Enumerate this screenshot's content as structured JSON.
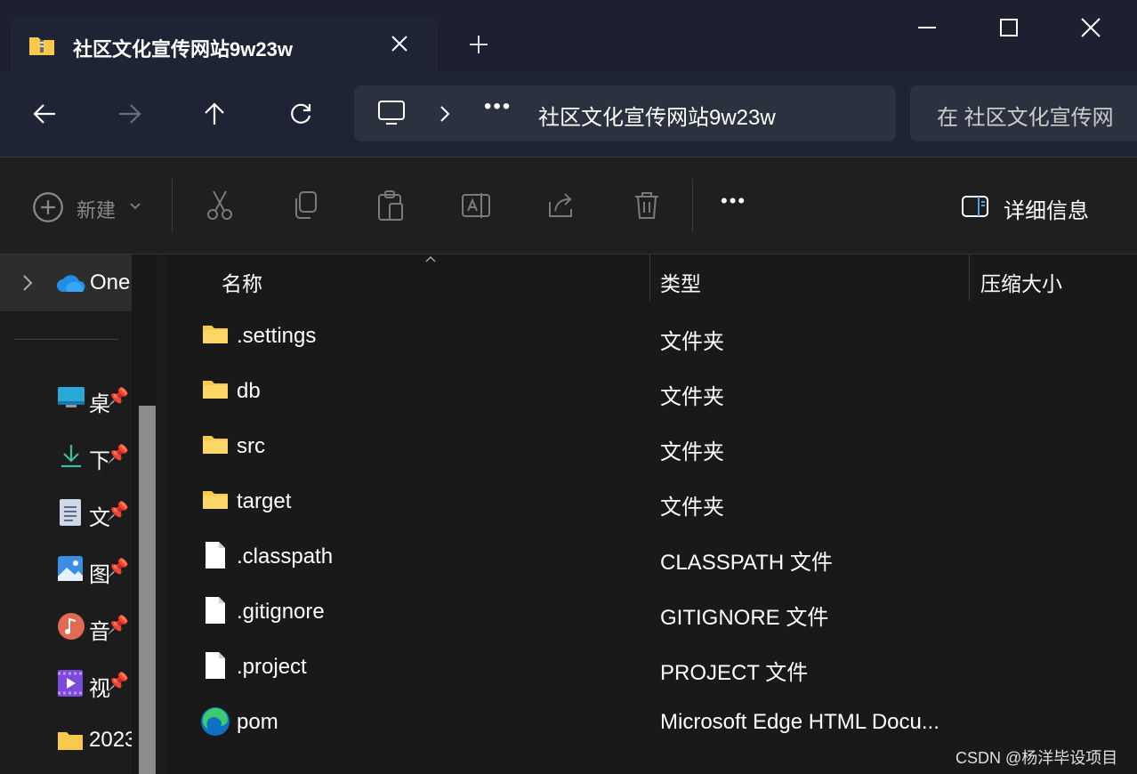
{
  "window": {
    "tab_title": "社区文化宣传网站9w23w",
    "tab_close_icon": "close-icon",
    "new_tab_icon": "plus-icon"
  },
  "nav": {
    "address_path": "社区文化宣传网站9w23w",
    "search_placeholder": "在 社区文化宣传网"
  },
  "command_bar": {
    "new_label": "新建",
    "details_label": "详细信息"
  },
  "sidebar": {
    "onedrive_label": "One",
    "items": [
      {
        "label": "桌",
        "icon": "desktop-icon"
      },
      {
        "label": "下",
        "icon": "download-icon"
      },
      {
        "label": "文",
        "icon": "documents-icon"
      },
      {
        "label": "图",
        "icon": "pictures-icon"
      },
      {
        "label": "音",
        "icon": "music-icon"
      },
      {
        "label": "视",
        "icon": "videos-icon"
      },
      {
        "label": "2023",
        "icon": "folder-icon"
      }
    ]
  },
  "file_list": {
    "columns": [
      "名称",
      "类型",
      "压缩大小"
    ],
    "rows": [
      {
        "name": ".settings",
        "type": "文件夹",
        "icon": "folder-icon"
      },
      {
        "name": "db",
        "type": "文件夹",
        "icon": "folder-icon"
      },
      {
        "name": "src",
        "type": "文件夹",
        "icon": "folder-icon"
      },
      {
        "name": "target",
        "type": "文件夹",
        "icon": "folder-icon"
      },
      {
        "name": ".classpath",
        "type": "CLASSPATH 文件",
        "icon": "file-icon"
      },
      {
        "name": ".gitignore",
        "type": "GITIGNORE 文件",
        "icon": "file-icon"
      },
      {
        "name": ".project",
        "type": "PROJECT 文件",
        "icon": "file-icon"
      },
      {
        "name": "pom",
        "type": "Microsoft Edge HTML Docu...",
        "icon": "edge-icon"
      }
    ]
  },
  "watermark": "CSDN @杨洋毕设项目",
  "colors": {
    "titlebar": "#1c2030",
    "background": "#191919",
    "folder": "#f8c94a"
  }
}
